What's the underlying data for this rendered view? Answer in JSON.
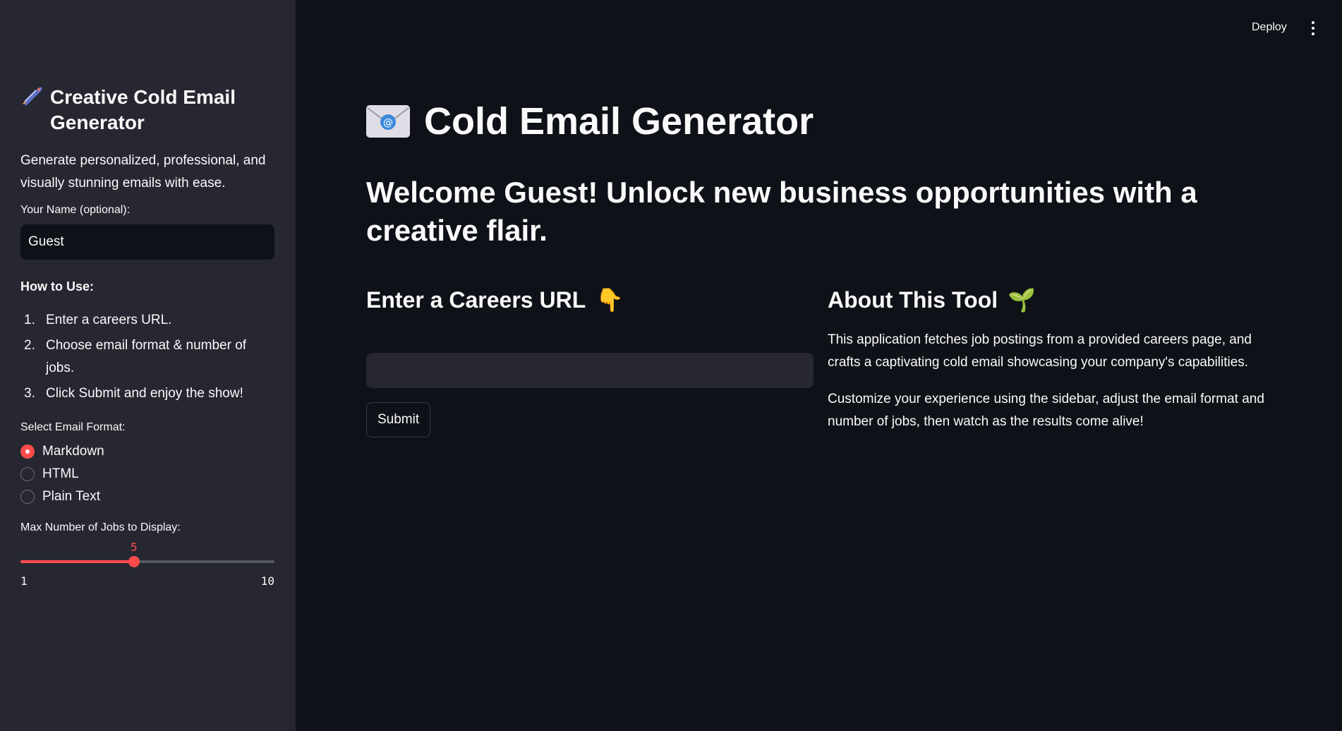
{
  "sidebar": {
    "title": "Creative Cold Email Generator",
    "title_icon": "rocket-icon",
    "description": "Generate personalized, professional, and visually stunning emails with ease.",
    "name_label": "Your Name (optional):",
    "name_value": "Guest",
    "howto_heading": "How to Use:",
    "howto_steps": [
      {
        "num": "1.",
        "text": "Enter a careers URL."
      },
      {
        "num": "2.",
        "text": "Choose email format & number of jobs."
      },
      {
        "num": "3.",
        "text": "Click Submit and enjoy the show!"
      }
    ],
    "format_label": "Select Email Format:",
    "format_options": [
      "Markdown",
      "HTML",
      "Plain Text"
    ],
    "format_selected": "Markdown",
    "jobs_label": "Max Number of Jobs to Display:",
    "jobs_value": "5",
    "jobs_min": "1",
    "jobs_max": "10"
  },
  "topbar": {
    "deploy_label": "Deploy",
    "menu_icon": "kebab-menu-icon"
  },
  "main": {
    "title": "Cold Email Generator",
    "title_icon": "envelope-icon",
    "welcome": "Welcome Guest! Unlock new business opportunities with a creative flair.",
    "url_heading": "Enter a Careers URL",
    "url_heading_emoji": "👇",
    "url_value": "",
    "submit_label": "Submit",
    "about_heading": "About This Tool",
    "about_heading_emoji": "🌱",
    "about_p1": "This application fetches job postings from a provided careers page, and crafts a captivating cold email showcasing your company's capabilities.",
    "about_p2": "Customize your experience using the sidebar, adjust the email format and number of jobs, then watch as the results come alive!"
  },
  "colors": {
    "accent": "#ff4b4b",
    "background": "#0e1117",
    "sidebar": "#262730"
  }
}
